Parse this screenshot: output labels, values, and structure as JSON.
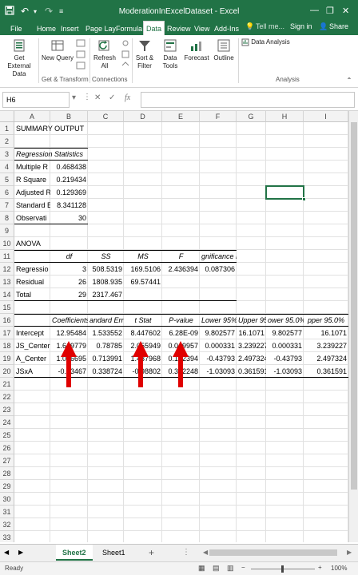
{
  "titlebar": {
    "title": "ModerationInExcelDataset - Excel",
    "save_icon": "save-icon",
    "undo_icon": "undo-icon",
    "redo_icon": "redo-icon",
    "minimize": "—",
    "restore": "❐",
    "close": "✕"
  },
  "tabs": [
    {
      "label": "File"
    },
    {
      "label": "Home"
    },
    {
      "label": "Insert"
    },
    {
      "label": "Page Lay"
    },
    {
      "label": "Formula"
    },
    {
      "label": "Data"
    },
    {
      "label": "Review"
    },
    {
      "label": "View"
    },
    {
      "label": "Add-Ins"
    }
  ],
  "tell_me": "Tell me...",
  "sign_in": "Sign in",
  "share": "Share",
  "ribbon": {
    "get_external": "Get External Data",
    "new_query": "New Query",
    "refresh_all": "Refresh All",
    "sort_filter": "Sort & Filter",
    "data_tools": "Data Tools",
    "forecast": "Forecast",
    "outline": "Outline",
    "data_analysis": "Data Analysis",
    "group_get_transform": "Get & Transform",
    "group_connections": "Connections",
    "group_analysis": "Analysis"
  },
  "namebox": "H6",
  "fx": "fx",
  "columns": [
    "A",
    "B",
    "C",
    "D",
    "E",
    "F",
    "G",
    "H",
    "I"
  ],
  "rows": [
    "1",
    "2",
    "3",
    "4",
    "5",
    "6",
    "7",
    "8",
    "9",
    "10",
    "11",
    "12",
    "13",
    "14",
    "15",
    "16",
    "17",
    "18",
    "19",
    "20",
    "21",
    "22",
    "23",
    "24",
    "25",
    "26",
    "27",
    "28",
    "29",
    "30",
    "31",
    "32",
    "33"
  ],
  "cells": {
    "A1": "SUMMARY OUTPUT",
    "A3": "Regression Statistics",
    "A4": "Multiple R",
    "B4": "0.468438",
    "A5": "R Square",
    "B5": "0.219434",
    "A6": "Adjusted R",
    "B6": "0.129369",
    "A7": "Standard E",
    "B7": "8.341128",
    "A8": "Observati",
    "B8": "30",
    "A10": "ANOVA",
    "B11": "df",
    "C11": "SS",
    "D11": "MS",
    "E11": "F",
    "F11": "gnificance F",
    "A12": "Regressio",
    "B12": "3",
    "C12": "508.5319",
    "D12": "169.5106",
    "E12": "2.436394",
    "F12": "0.087306",
    "A13": "Residual",
    "B13": "26",
    "C13": "1808.935",
    "D13": "69.57441",
    "A14": "Total",
    "B14": "29",
    "C14": "2317.467",
    "B16": "Coefficients",
    "C16": "andard Err",
    "D16": "t Stat",
    "E16": "P-value",
    "F16": "Lower 95%",
    "G16": "Upper 95%",
    "H16": "ower 95.0%",
    "I16": "pper 95.0%",
    "A17": "Intercept",
    "B17": "12.95484",
    "C17": "1.533552",
    "D17": "8.447602",
    "E17": "6.28E-09",
    "F17": "9.802577",
    "G17": "16.1071",
    "H17": "9.802577",
    "I17": "16.1071",
    "A18": "JS_Center",
    "B18": "1.619779",
    "C18": "0.78785",
    "D18": "2.055949",
    "E18": "0.049957",
    "F18": "0.000331",
    "G18": "3.239227",
    "H18": "0.000331",
    "I18": "3.239227",
    "A19": "A_Center",
    "B19": "1.026695",
    "C19": "0.713991",
    "D19": "1.437968",
    "E19": "0.162394",
    "F19": "-0.43793",
    "G19": "2.497324",
    "H19": "-0.43793",
    "I19": "2.497324",
    "A20": "JSxA",
    "B20": "-0.33467",
    "C20": "0.338724",
    "D20": "-0.98802",
    "E20": "0.332248",
    "F20": "-1.03093",
    "G20": "0.361591",
    "H20": "-1.03093",
    "I20": "0.361591"
  },
  "sheets": [
    {
      "label": "Sheet2",
      "active": true
    },
    {
      "label": "Sheet1",
      "active": false
    }
  ],
  "add_sheet": "+",
  "status": {
    "ready": "Ready",
    "zoom": "100%"
  },
  "colors": {
    "excel_green": "#217346",
    "arrow_red": "#e00000"
  }
}
